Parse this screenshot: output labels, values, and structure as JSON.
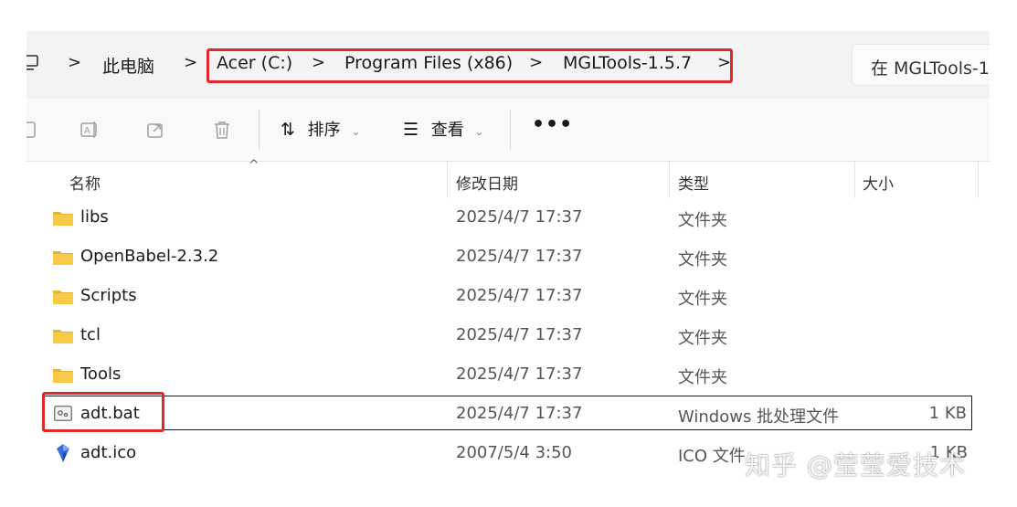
{
  "address_bar": {
    "crumbs": [
      "此电脑",
      "Acer (C:)",
      "Program Files (x86)",
      "MGLTools-1.5.7"
    ],
    "search_placeholder": "在 MGLTools-1"
  },
  "toolbar": {
    "sort_label": "排序",
    "view_label": "查看",
    "more_label": "•••"
  },
  "columns": {
    "name": "名称",
    "modified": "修改日期",
    "type": "类型",
    "size": "大小"
  },
  "files": [
    {
      "name": "libs",
      "modified": "2025/4/7 17:37",
      "type": "文件夹",
      "size": "",
      "icon": "folder-icon"
    },
    {
      "name": "OpenBabel-2.3.2",
      "modified": "2025/4/7 17:37",
      "type": "文件夹",
      "size": "",
      "icon": "folder-icon"
    },
    {
      "name": "Scripts",
      "modified": "2025/4/7 17:37",
      "type": "文件夹",
      "size": "",
      "icon": "folder-icon"
    },
    {
      "name": "tcl",
      "modified": "2025/4/7 17:37",
      "type": "文件夹",
      "size": "",
      "icon": "folder-icon"
    },
    {
      "name": "Tools",
      "modified": "2025/4/7 17:37",
      "type": "文件夹",
      "size": "",
      "icon": "folder-icon"
    },
    {
      "name": "adt.bat",
      "modified": "2025/4/7 17:37",
      "type": "Windows 批处理文件",
      "size": "1 KB",
      "icon": "batch-file-icon"
    },
    {
      "name": "adt.ico",
      "modified": "2007/5/4 3:50",
      "type": "ICO 文件",
      "size": "1 KB",
      "icon": "ico-file-icon"
    }
  ],
  "watermark": "知乎 @莹莹爱技术",
  "colors": {
    "highlight": "#e0272b",
    "folder": "#f7c948"
  }
}
